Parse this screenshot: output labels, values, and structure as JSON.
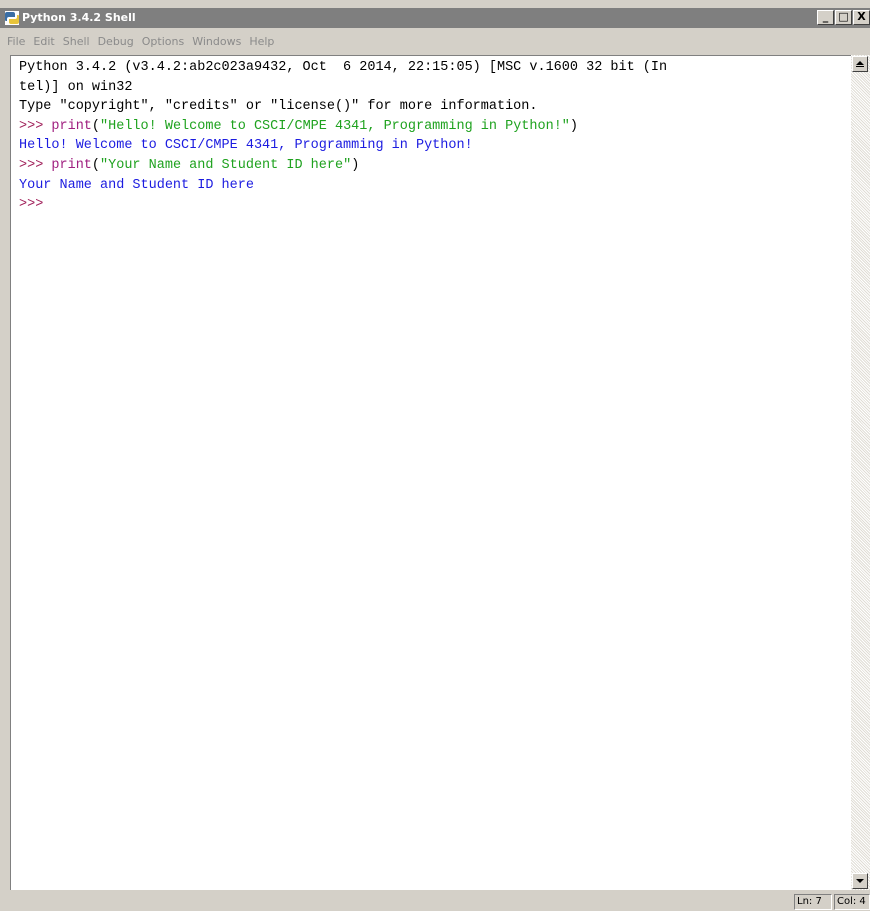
{
  "window": {
    "title": "Python 3.4.2 Shell",
    "minimize_glyph": "_",
    "maximize_glyph": "□",
    "close_glyph": "X"
  },
  "menu": {
    "items": [
      "File",
      "Edit",
      "Shell",
      "Debug",
      "Options",
      "Windows",
      "Help"
    ]
  },
  "shell": {
    "banner_line1": "Python 3.4.2 (v3.4.2:ab2c023a9432, Oct  6 2014, 22:15:05) [MSC v.1600 32 bit (In",
    "banner_line2": "tel)] on win32",
    "info_line": "Type \"copyright\", \"credits\" or \"license()\" for more information.",
    "cmd1_prompt": ">>> ",
    "cmd1_keyword": "print",
    "cmd1_open": "(",
    "cmd1_string": "\"Hello! Welcome to CSCI/CMPE 4341, Programming in Python!\"",
    "cmd1_close": ")",
    "out1": "Hello! Welcome to CSCI/CMPE 4341, Programming in Python!",
    "cmd2_prompt": ">>> ",
    "cmd2_keyword": "print",
    "cmd2_open": "(",
    "cmd2_string": "\"Your Name and Student ID here\"",
    "cmd2_close": ")",
    "out2": "Your Name and Student ID here",
    "final_prompt": ">>> "
  },
  "status": {
    "line": "Ln: 7",
    "col": "Col: 4"
  },
  "colors": {
    "titlebar": "#7f7f7f",
    "prompt": "#a0205a",
    "keyword": "#a02080",
    "string": "#1fa21f",
    "output": "#1c1ce0",
    "menu_text": "#8a8a8a"
  }
}
